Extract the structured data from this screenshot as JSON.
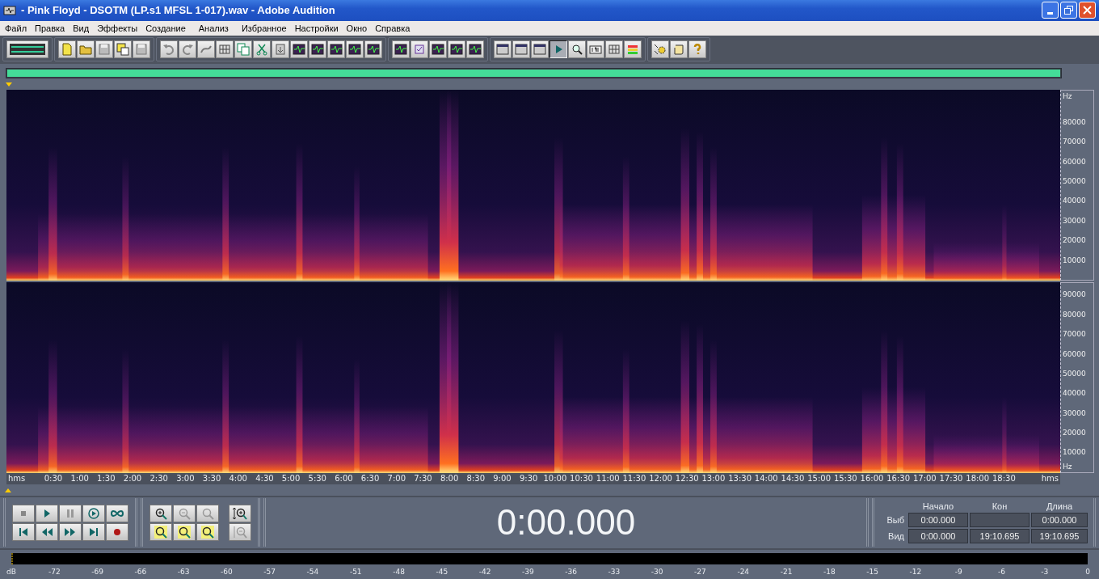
{
  "window": {
    "title": "- Pink Floyd - DSOTM (LP.s1 MFSL 1-017).wav - Adobe Audition"
  },
  "menu": [
    "Файл",
    "Правка",
    "Вид",
    "Эффекты",
    "Создание",
    "Анализ",
    "Избранное",
    "Настройки",
    "Окно",
    "Справка"
  ],
  "toolbar": [
    {
      "buttons": [
        {
          "pressed": false
        }
      ]
    },
    {
      "buttons": [
        {
          "pressed": false
        },
        {
          "pressed": false
        },
        {
          "pressed": false
        },
        {
          "pressed": false
        },
        {
          "pressed": false
        }
      ]
    },
    {
      "buttons": [
        {
          "pressed": false
        },
        {
          "pressed": false
        },
        {
          "pressed": false
        },
        {
          "pressed": false
        },
        {
          "pressed": false
        },
        {
          "pressed": false
        },
        {
          "pressed": false
        },
        {
          "pressed": false
        },
        {
          "pressed": false
        },
        {
          "pressed": false
        },
        {
          "pressed": false
        },
        {
          "pressed": false
        }
      ]
    },
    {
      "buttons": [
        {
          "pressed": false
        },
        {
          "pressed": false
        },
        {
          "pressed": false
        },
        {
          "pressed": false
        },
        {
          "pressed": false
        }
      ]
    },
    {
      "buttons": [
        {
          "pressed": false
        },
        {
          "pressed": false
        },
        {
          "pressed": false
        },
        {
          "pressed": true
        },
        {
          "pressed": false
        },
        {
          "pressed": false
        },
        {
          "pressed": false
        },
        {
          "pressed": false
        }
      ]
    },
    {
      "buttons": [
        {
          "pressed": false
        },
        {
          "pressed": false
        },
        {
          "pressed": false
        }
      ]
    }
  ],
  "progress": {
    "level": 1
  },
  "channels": [
    {
      "unit_top": "Hz",
      "ticks": [
        "80000",
        "70000",
        "60000",
        "50000",
        "40000",
        "30000",
        "20000",
        "10000"
      ]
    },
    {
      "unit_bottom": "Hz",
      "ticks": [
        "90000",
        "80000",
        "70000",
        "60000",
        "50000",
        "40000",
        "30000",
        "20000",
        "10000"
      ]
    }
  ],
  "time_ruler": {
    "unit_left": "hms",
    "labels": [
      "0:30",
      "1:00",
      "1:30",
      "2:00",
      "2:30",
      "3:00",
      "3:30",
      "4:00",
      "4:30",
      "5:00",
      "5:30",
      "6:00",
      "6:30",
      "7:00",
      "7:30",
      "8:00",
      "8:30",
      "9:00",
      "9:30",
      "10:00",
      "10:30",
      "11:00",
      "11:30",
      "12:00",
      "12:30",
      "13:00",
      "13:30",
      "14:00",
      "14:30",
      "15:00",
      "15:30",
      "16:00",
      "16:30",
      "17:00",
      "17:30",
      "18:00",
      "18:30"
    ],
    "unit_right": "hms"
  },
  "time_display": "0:00.000",
  "selection": {
    "headers": [
      "Начало",
      "Кон",
      "Длина"
    ],
    "rows": [
      {
        "label": "Выб",
        "begin": "0:00.000",
        "length": "0:00.000"
      },
      {
        "label": "Вид",
        "begin": "0:00.000",
        "end": "19:10.695",
        "length": "19:10.695"
      }
    ]
  },
  "level_meter": {
    "labels": [
      "dB",
      "-72",
      "-69",
      "-66",
      "-63",
      "-60",
      "-57",
      "-54",
      "-51",
      "-48",
      "-45",
      "-42",
      "-39",
      "-36",
      "-33",
      "-30",
      "-27",
      "-24",
      "-21",
      "-18",
      "-15",
      "-12",
      "-9",
      "-6",
      "-3",
      "0"
    ]
  }
}
